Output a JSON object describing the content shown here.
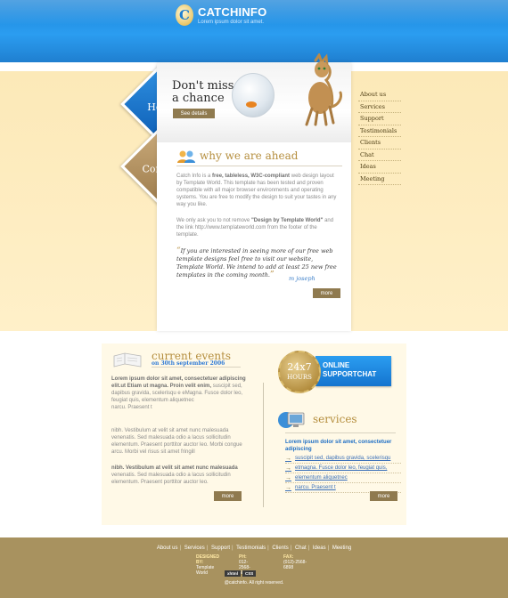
{
  "header": {
    "logo_letter": "C",
    "brand": "CATCHINFO",
    "tagline": "Lorem ipsum dolor sit amet."
  },
  "side_tabs": {
    "home": "Home",
    "contact": "Contact"
  },
  "hero": {
    "title_line1": "Don't miss",
    "title_line2": "a chance",
    "details_button": "See details"
  },
  "why": {
    "title": "why we are ahead",
    "p1_a": "Catch Info is a ",
    "p1_bold": "free, tableless, W3C-compliant",
    "p1_b": " web design layout by Template World. This template has been tested and proven compatible with all major browser environments and operating systems. You are free to modify the design to suit your tastes in any way you like.",
    "p2_a": "We only ask you to not remove ",
    "p2_bold": "\"Design by Template World\"",
    "p2_b": " and the link http://www.templateworld.com from the footer of the template.",
    "quote": "If you are interested in seeing more of our free web template designs feel free to visit our website, Template World. We intend to add at least 25 new free templates in the coming month.",
    "author": "m joseph",
    "more": "more"
  },
  "menu": {
    "items": [
      "About us",
      "Services",
      "Support",
      "Testimonials",
      "Clients",
      "Chat",
      "Ideas",
      "Meeting"
    ]
  },
  "events": {
    "title": "current events",
    "date": "on 30th september 2006",
    "e1_bold": "Lorem ipsum dolor sit amet, consectetuer adipiscing elit.ut Etiam ut magna. Proin velit enim,",
    "e1_text": " suscipit sed, dapibus gravida, scelerisqu e eMagna. Fusce dolor leo, feugiat quis, elementum aliquetnec",
    "e1_tail": "narcu. Praesent t",
    "e2": "nibh. Vestibulum at velit sit amet nunc malesuada venenatis. Sed malesuada odio a lacus sollicitudin elementum. Praesent porttitor auctor leo. Morbi congue arcu. Morbi vel risus sit amet fringill",
    "e3_bold": "nibh. Vestibulum at velit sit amet nunc malesuada",
    "e3_text": " venenatis. Sed malesuada odio a lacus sollicitudin elementum. Praesent porttitor auctor leo.",
    "more": "more"
  },
  "support": {
    "seal_top": "24x7",
    "seal_bottom": "HOURS",
    "line1": "ONLINE",
    "line2": "SUPPORTCHAT"
  },
  "services": {
    "title": "services",
    "lead": "Lorem ipsum dolor sit amet, consectetuer adipiscing",
    "items": [
      "suscipit sed, dapibus gravida, scelerisqu",
      "etmagna. Fusce dolor leo, feugiat quis,",
      "elementum aliquetnec",
      "narcu. Praesent t"
    ],
    "more": "more"
  },
  "footer": {
    "nav": [
      "About us",
      "Services",
      "Support",
      "Testimonials",
      "Clients",
      "Chat",
      "Ideas",
      "Meeting"
    ],
    "designed_by_label": "DESIGNED BY:",
    "designed_by": "Template World",
    "ph_label": "PH:",
    "ph": "012-2568-6897",
    "fax_label": "FAX:",
    "fax": "(012)-2568-6898",
    "badge1": "xhtml",
    "badge2": "CSS",
    "copyright": "@catchinfo. All right reserved."
  },
  "colors": {
    "header_blue": "#2b9df0",
    "accent_gold": "#b58e3e",
    "button_brown": "#8f7a4f",
    "band_cream": "#fce9b8",
    "footer_tan": "#a8925f"
  }
}
